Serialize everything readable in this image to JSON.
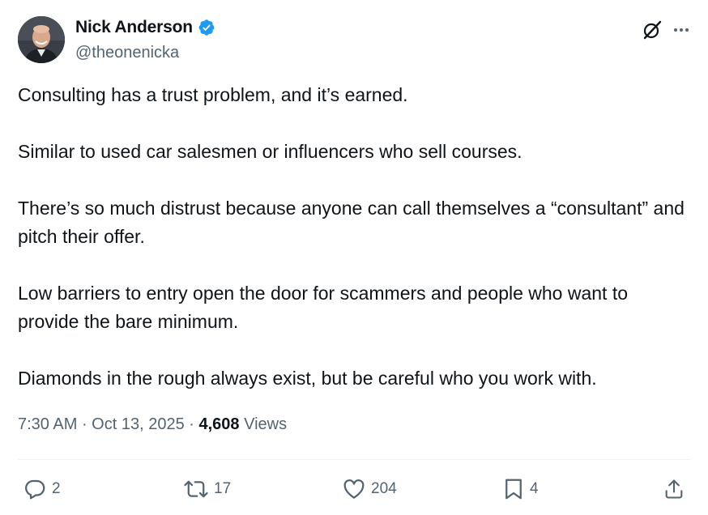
{
  "author": {
    "display_name": "Nick Anderson",
    "handle": "@theonenicka",
    "verified": true,
    "verified_color": "#1d9bf0"
  },
  "tweet": {
    "paragraphs": [
      "Consulting has a trust problem, and it’s earned.",
      "Similar to used car salesmen or influencers who sell courses.",
      "There’s so much distrust because anyone can call themselves a “consultant” and pitch their offer.",
      "Low barriers to entry open the door for scammers and people who want to provide the bare minimum.",
      "Diamonds in the rough always exist, but be careful who you work with."
    ],
    "time": "7:30 AM",
    "date": "Oct 13, 2025",
    "views_count": "4,608",
    "views_label": "Views"
  },
  "actions": {
    "replies": "2",
    "reposts": "17",
    "likes": "204",
    "bookmarks": "4"
  },
  "icons": {
    "grok": "grok-icon",
    "more": "more-icon",
    "reply": "reply-icon",
    "repost": "repost-icon",
    "like": "like-icon",
    "bookmark": "bookmark-icon",
    "share": "share-icon",
    "verified": "verified-badge-icon"
  },
  "colors": {
    "text_primary": "#0f1419",
    "text_secondary": "#536471",
    "divider": "#eff3f4"
  }
}
